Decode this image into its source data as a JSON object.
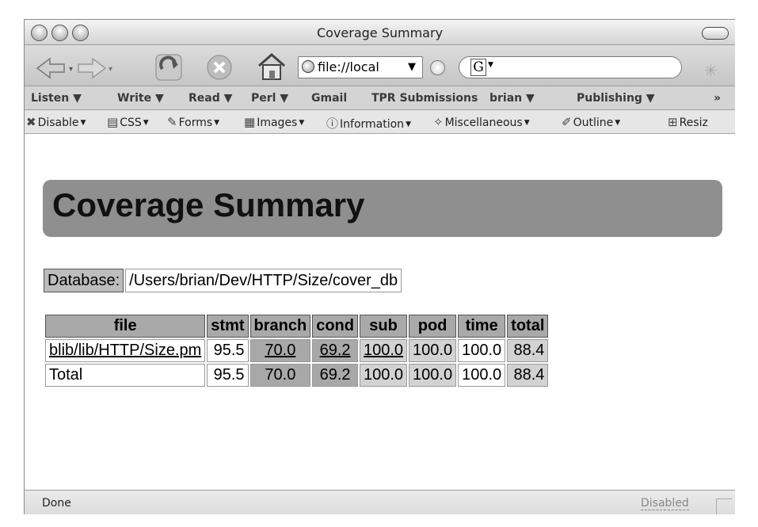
{
  "window": {
    "title": "Coverage Summary"
  },
  "toolbar": {
    "url": "file://local",
    "icons": [
      "back-icon",
      "forward-icon",
      "reload-icon",
      "stop-icon",
      "home-icon",
      "globe-icon",
      "go-icon",
      "google-icon",
      "spinner-icon"
    ],
    "search_engine_letter": "G"
  },
  "bookmarks": {
    "items": [
      {
        "label": "Listen ▼"
      },
      {
        "label": "Write ▼"
      },
      {
        "label": "Read ▼"
      },
      {
        "label": "Perl ▼"
      },
      {
        "label": "Gmail"
      },
      {
        "label": "TPR Submissions"
      },
      {
        "label": "brian ▼"
      },
      {
        "label": "Publishing ▼"
      }
    ],
    "overflow": "»"
  },
  "devbar": {
    "items": [
      {
        "label": "Disable",
        "icon": "disable-icon"
      },
      {
        "label": "CSS",
        "icon": "css-icon"
      },
      {
        "label": "Forms",
        "icon": "forms-icon"
      },
      {
        "label": "Images",
        "icon": "images-icon"
      },
      {
        "label": "Information",
        "icon": "information-icon"
      },
      {
        "label": "Miscellaneous",
        "icon": "miscellaneous-icon"
      },
      {
        "label": "Outline",
        "icon": "outline-icon"
      },
      {
        "label": "Resiz",
        "icon": "resize-icon"
      }
    ]
  },
  "page": {
    "heading": "Coverage Summary",
    "database_label": "Database:",
    "database_value": "/Users/brian/Dev/HTTP/Size/cover_db",
    "table": {
      "headers": [
        "file",
        "stmt",
        "branch",
        "cond",
        "sub",
        "pod",
        "time",
        "total"
      ],
      "rows": [
        [
          "blib/lib/HTTP/Size.pm",
          "95.5",
          "70.0",
          "69.2",
          "100.0",
          "100.0",
          "100.0",
          "88.4"
        ],
        [
          "Total",
          "95.5",
          "70.0",
          "69.2",
          "100.0",
          "100.0",
          "100.0",
          "88.4"
        ]
      ]
    }
  },
  "status": {
    "text": "Done",
    "right": "Disabled"
  }
}
